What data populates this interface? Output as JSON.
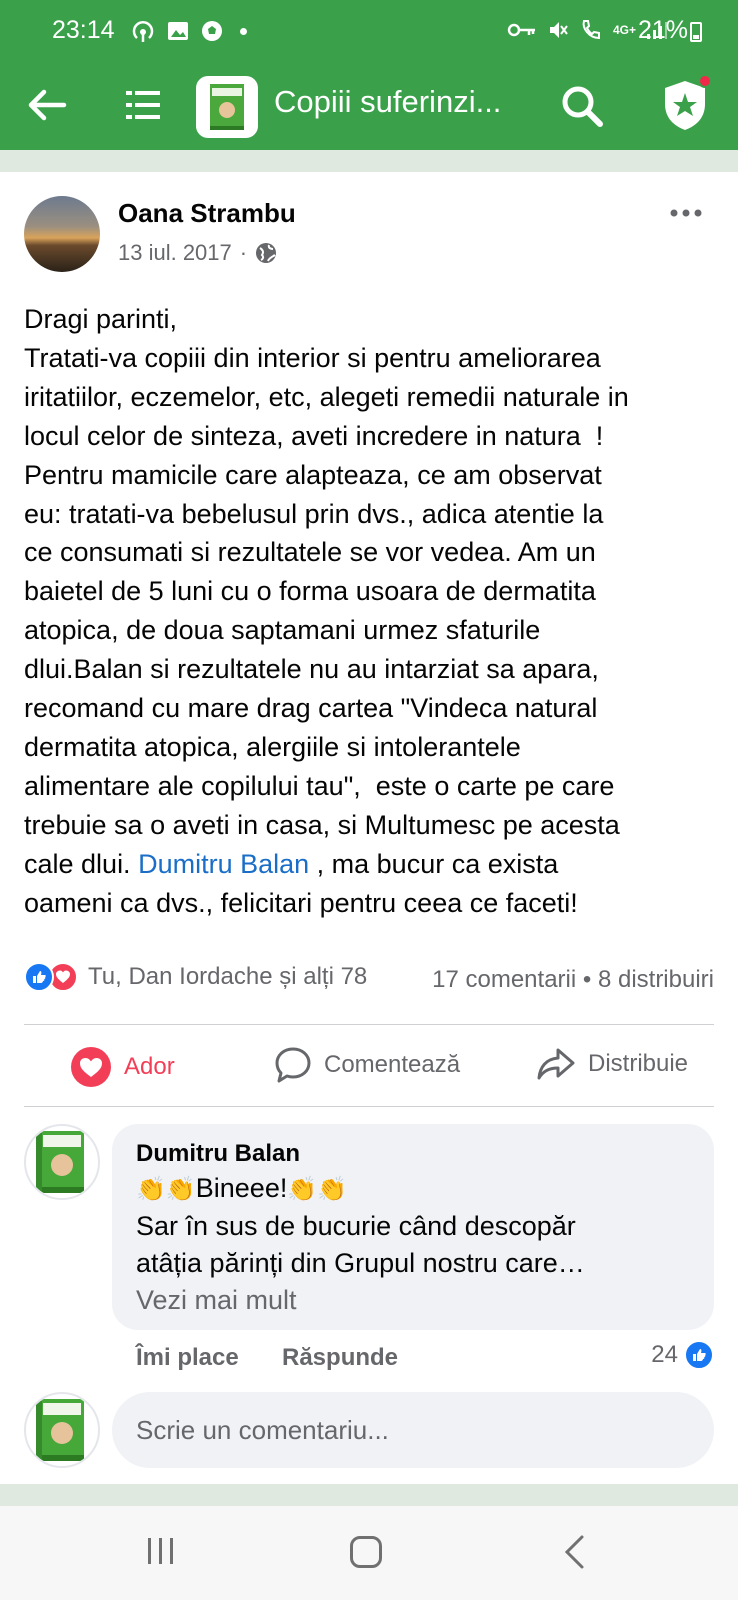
{
  "status_bar": {
    "time": "23:14",
    "network": "4G+",
    "battery": "21%"
  },
  "app_bar": {
    "title": "Copiii suferinzi...",
    "accent": "#3aa04a"
  },
  "post": {
    "author": "Oana Strambu",
    "date": "13 iul. 2017",
    "date_separator": "·",
    "body_lines": [
      "Dragi parinti,",
      "Tratati-va copiii din interior si pentru ameliorarea",
      "iritatiilor, eczemelor, etc, alegeti remedii naturale in",
      "locul celor de sinteza, aveti incredere in natura  !",
      "Pentru mamicile care alapteaza, ce am observat",
      "eu: tratati-va bebelusul prin dvs., adica atentie la",
      "ce consumati si rezultatele se vor vedea. Am un",
      "baietel de 5 luni cu o forma usoara de dermatita",
      "atopica, de doua saptamani urmez sfaturile",
      "dlui.Balan si rezultatele nu au intarziat sa apara,",
      "recomand cu mare drag cartea \"Vindeca natural",
      "dermatita atopica, alergiile si intolerantele",
      "alimentare ale copilului tau\",  este o carte pe care",
      "trebuie sa o aveti in casa, si Multumesc pe acesta"
    ],
    "line_15_before": "cale dlui. ",
    "mention": "Dumitru Balan",
    "line_15_after": " , ma bucur ca exista",
    "last_line": "oameni ca dvs., felicitari pentru ceea ce faceti!",
    "reactions_names": "Tu, Dan Iordache și alți 78",
    "comments_count": "17 comentarii",
    "counts_separator": "•",
    "shares_count": "8 distribuiri"
  },
  "actions": {
    "love": "Ador",
    "comment": "Comentează",
    "share": "Distribuie"
  },
  "comment": {
    "author": "Dumitru Balan",
    "text_1": "Bineee!",
    "text_2": "Sar în sus de bucurie când descopăr",
    "text_3": "atâția părinți din Grupul nostru care…",
    "see_more": "Vezi mai mult",
    "like": "Îmi place",
    "reply": "Răspunde",
    "like_count": "24"
  },
  "composer": {
    "placeholder": "Scrie un comentariu..."
  }
}
